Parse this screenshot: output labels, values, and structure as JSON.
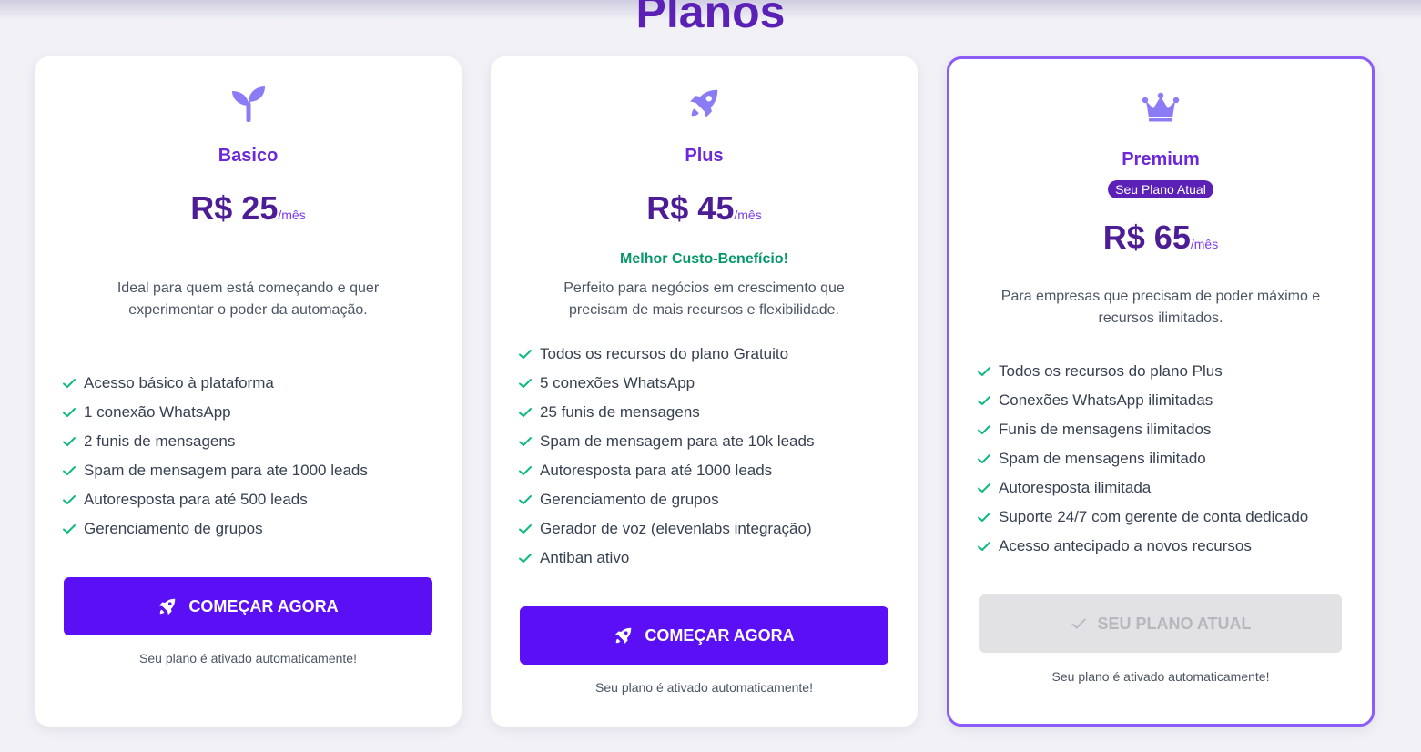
{
  "page_title": "Planos",
  "plans": [
    {
      "name": "Basico",
      "icon": "sprout-icon",
      "price": "R$ 25",
      "period": "/mês",
      "description": "Ideal para quem está começando e quer experimentar o poder da automação.",
      "features": [
        "Acesso básico à plataforma",
        "1 conexão WhatsApp",
        "2 funis de mensagens",
        "Spam de mensagem para ate 1000 leads",
        "Autoresposta para até 500 leads",
        "Gerenciamento de grupos"
      ],
      "button_label": "COMEÇAR AGORA",
      "note": "Seu plano é ativado automaticamente!"
    },
    {
      "name": "Plus",
      "icon": "rocket-icon",
      "price": "R$ 45",
      "period": "/mês",
      "highlight": "Melhor Custo-Benefício!",
      "description": "Perfeito para negócios em crescimento que precisam de mais recursos e flexibilidade.",
      "features": [
        "Todos os recursos do plano Gratuito",
        "5 conexões WhatsApp",
        "25 funis de mensagens",
        "Spam de mensagem para ate 10k leads",
        "Autoresposta para até 1000 leads",
        "Gerenciamento de grupos",
        "Gerador de voz (elevenlabs integração)",
        "Antiban ativo"
      ],
      "button_label": "COMEÇAR AGORA",
      "note": "Seu plano é ativado automaticamente!"
    },
    {
      "name": "Premium",
      "icon": "crown-icon",
      "badge": "Seu Plano Atual",
      "price": "R$ 65",
      "period": "/mês",
      "description": "Para empresas que precisam de poder máximo e recursos ilimitados.",
      "features": [
        "Todos os recursos do plano Plus",
        "Conexões WhatsApp ilimitadas",
        "Funis de mensagens ilimitados",
        "Spam de mensagens ilimitado",
        "Autoresposta ilimitada",
        "Suporte 24/7 com gerente de conta dedicado",
        "Acesso antecipado a novos recursos"
      ],
      "button_label": "SEU PLANO ATUAL",
      "note": "Seu plano é ativado automaticamente!"
    }
  ],
  "colors": {
    "accent": "#5b0ff5",
    "title": "#5b21b6",
    "check": "#10b981",
    "highlight": "#059669",
    "current_border": "#8b5cf6"
  }
}
